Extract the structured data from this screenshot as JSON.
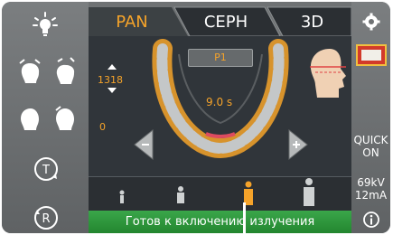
{
  "tabs": [
    {
      "label": "PAN",
      "active": true
    },
    {
      "label": "CEPH",
      "active": false
    },
    {
      "label": "3D",
      "active": false
    }
  ],
  "program": {
    "label": "P1"
  },
  "height_value": "1318",
  "height_zero": "0",
  "scan_time": "9.0 s",
  "quick_mode": {
    "line1": "QUICK",
    "line2": "ON"
  },
  "exposure": {
    "kv": "69kV",
    "ma": "12mA"
  },
  "status_message": "Готов к включению излучения",
  "patient_size_selected": 2,
  "colors": {
    "accent": "#f5a32a",
    "status_green": "#2f9a3c",
    "panel_gray": "#6f7274"
  },
  "icons": [
    "light-icon",
    "head-tilt-icon",
    "head-rotate-icon",
    "timer-icon",
    "reset-icon",
    "settings-icon",
    "monitor-image-icon",
    "info-icon"
  ]
}
